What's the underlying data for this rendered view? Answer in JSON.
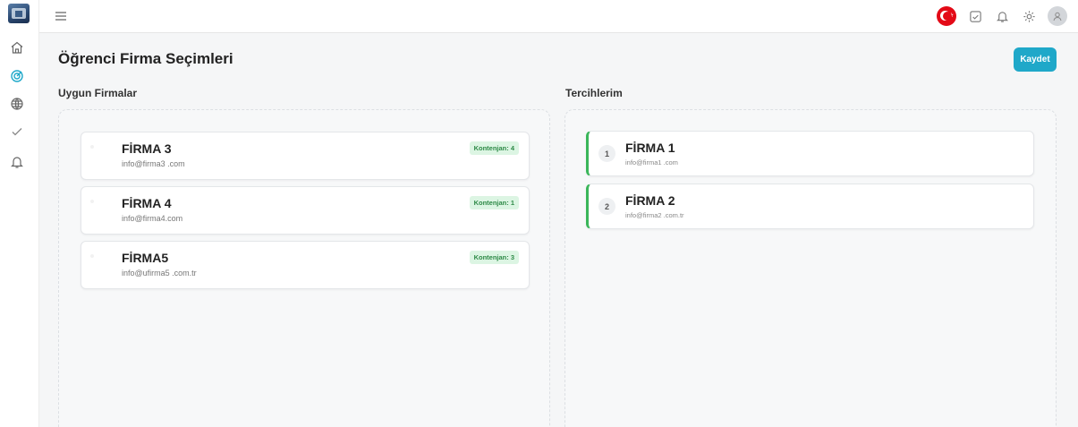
{
  "app": {
    "logo_icon": "app-logo",
    "accent_color": "#1fa8c9",
    "success_color": "#3ab65a"
  },
  "sidebar": {
    "items": [
      {
        "icon": "home-icon"
      },
      {
        "icon": "target-icon",
        "active": true
      },
      {
        "icon": "globe-icon"
      },
      {
        "icon": "check-icon"
      },
      {
        "icon": "bell-icon"
      }
    ]
  },
  "topbar": {
    "menu_icon": "menu-icon",
    "icons": [
      "turkey-flag-icon",
      "checkbox-icon",
      "bell-icon",
      "gear-icon",
      "user-avatar-icon"
    ]
  },
  "page": {
    "title": "Öğrenci Firma Seçimleri",
    "save_label": "Kaydet"
  },
  "available": {
    "title": "Uygun Firmalar",
    "firms": [
      {
        "name": "FİRMA 3",
        "email": "info@firma3 .com",
        "quota": "Kontenjan: 4"
      },
      {
        "name": "FİRMA 4",
        "email": "info@firma4.com",
        "quota": "Kontenjan: 1"
      },
      {
        "name": "FİRMA5",
        "email": "info@ufirma5 .com.tr",
        "quota": "Kontenjan: 3"
      }
    ]
  },
  "preferences": {
    "title": "Tercihlerim",
    "firms": [
      {
        "rank": "1",
        "name": "FİRMA 1",
        "email": "info@firma1 .com"
      },
      {
        "rank": "2",
        "name": "FİRMA 2",
        "email": "info@firma2 .com.tr"
      }
    ]
  }
}
